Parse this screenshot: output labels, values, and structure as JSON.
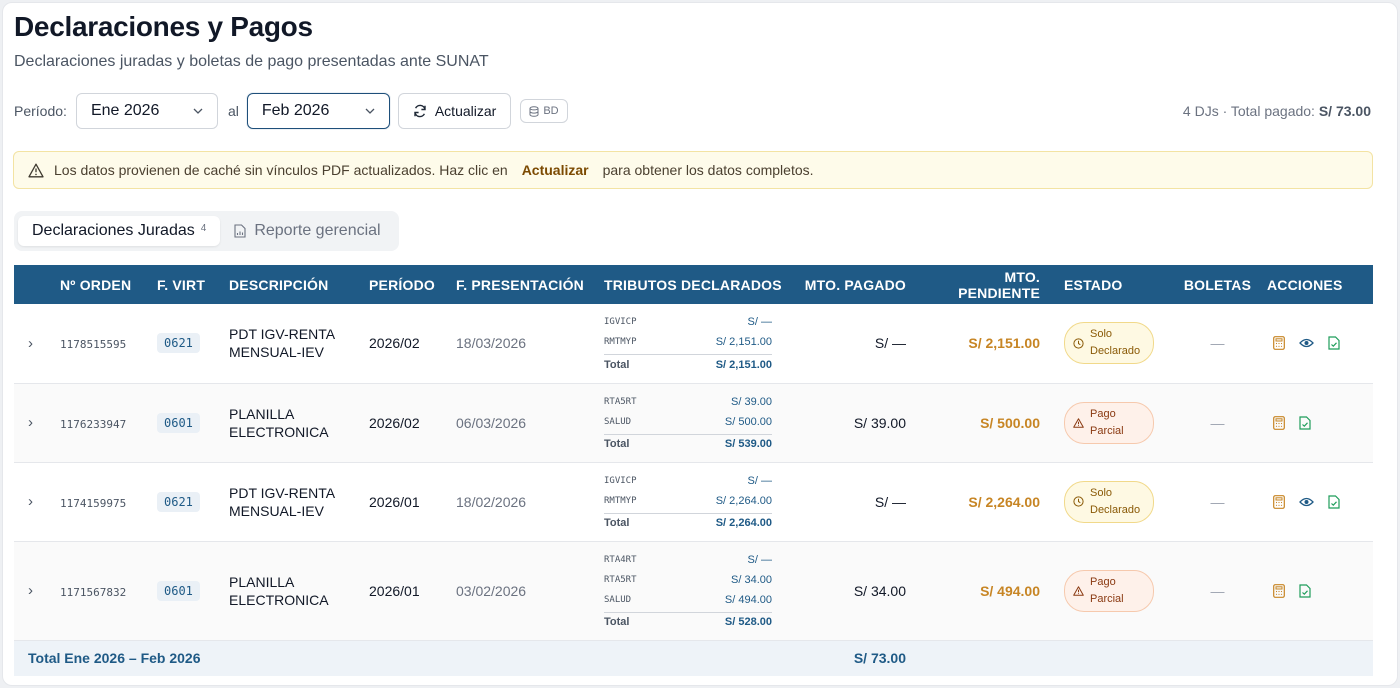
{
  "header": {
    "title": "Declaraciones y Pagos",
    "subtitle": "Declaraciones juradas y boletas de pago presentadas ante SUNAT"
  },
  "toolbar": {
    "periodo_label": "Período:",
    "from_value": "Ene 2026",
    "to_label": "al",
    "to_value": "Feb 2026",
    "refresh_label": "Actualizar",
    "bd_label": "BD",
    "summary_prefix": "4 DJs · Total pagado: ",
    "summary_total": "S/ 73.00"
  },
  "alert": {
    "text_before": "Los datos provienen de caché sin vínculos PDF actualizados. Haz clic en",
    "link": "Actualizar",
    "text_after": "para obtener los datos completos."
  },
  "tabs": [
    {
      "label": "Declaraciones Juradas",
      "count": "4"
    },
    {
      "label": "Reporte gerencial"
    }
  ],
  "table": {
    "columns": [
      "Nº ORDEN",
      "F. VIRT",
      "DESCRIPCIÓN",
      "PERÍODO",
      "F. PRESENTACIÓN",
      "TRIBUTOS DECLARADOS",
      "MTO. PAGADO",
      "MTO. PENDIENTE",
      "ESTADO",
      "BOLETAS",
      "ACCIONES"
    ],
    "rows": [
      {
        "orden": "1178515595",
        "fvirt": "0621",
        "desc1": "PDT IGV-RENTA",
        "desc2": "MENSUAL-IEV",
        "periodo": "2026/02",
        "fpres": "18/03/2026",
        "tributos": [
          {
            "code": "IGVICP",
            "amt": "S/ —"
          },
          {
            "code": "RMTMYP",
            "amt": "S/ 2,151.00"
          }
        ],
        "total_label": "Total",
        "total": "S/ 2,151.00",
        "pagado": "S/ —",
        "pendiente": "S/ 2,151.00",
        "estado1": "Solo",
        "estado2": "Declarado",
        "boletas": "—"
      },
      {
        "orden": "1176233947",
        "fvirt": "0601",
        "desc1": "PLANILLA",
        "desc2": "ELECTRONICA",
        "periodo": "2026/02",
        "fpres": "06/03/2026",
        "tributos": [
          {
            "code": "RTA5RT",
            "amt": "S/ 39.00"
          },
          {
            "code": "SALUD",
            "amt": "S/ 500.00"
          }
        ],
        "total_label": "Total",
        "total": "S/ 539.00",
        "pagado": "S/ 39.00",
        "pendiente": "S/ 500.00",
        "estado1": "Pago",
        "estado2": "Parcial",
        "boletas": "—"
      },
      {
        "orden": "1174159975",
        "fvirt": "0621",
        "desc1": "PDT IGV-RENTA",
        "desc2": "MENSUAL-IEV",
        "periodo": "2026/01",
        "fpres": "18/02/2026",
        "tributos": [
          {
            "code": "IGVICP",
            "amt": "S/ —"
          },
          {
            "code": "RMTMYP",
            "amt": "S/ 2,264.00"
          }
        ],
        "total_label": "Total",
        "total": "S/ 2,264.00",
        "pagado": "S/ —",
        "pendiente": "S/ 2,264.00",
        "estado1": "Solo",
        "estado2": "Declarado",
        "boletas": "—"
      },
      {
        "orden": "1171567832",
        "fvirt": "0601",
        "desc1": "PLANILLA",
        "desc2": "ELECTRONICA",
        "periodo": "2026/01",
        "fpres": "03/02/2026",
        "tributos": [
          {
            "code": "RTA4RT",
            "amt": "S/ —"
          },
          {
            "code": "RTA5RT",
            "amt": "S/ 34.00"
          },
          {
            "code": "SALUD",
            "amt": "S/ 494.00"
          }
        ],
        "total_label": "Total",
        "total": "S/ 528.00",
        "pagado": "S/ 34.00",
        "pendiente": "S/ 494.00",
        "estado1": "Pago",
        "estado2": "Parcial",
        "boletas": "—"
      }
    ],
    "footer_label": "Total Ene 2026 – Feb 2026",
    "footer_pagado": "S/ 73.00"
  },
  "colors": {
    "header_bg": "#1f5a86",
    "pending": "#c78524",
    "amount_blue": "#1f5a86"
  }
}
